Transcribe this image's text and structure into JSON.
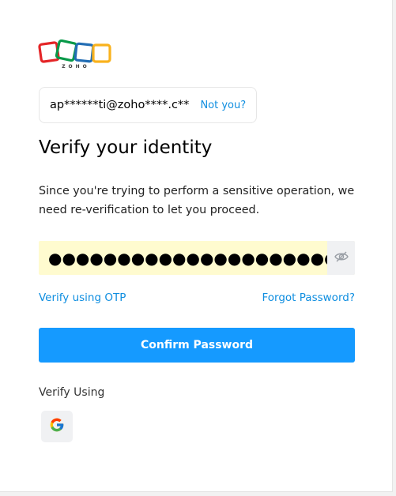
{
  "brand": {
    "logo_text": "ZOHO",
    "colors": {
      "red": "#e42527",
      "green": "#089949",
      "blue": "#226db4",
      "yellow": "#f9b21d"
    }
  },
  "account": {
    "email": "ap******ti@zoho****.c**",
    "not_you_label": "Not you?"
  },
  "heading": "Verify your identity",
  "description": "Since you're trying to perform a sensitive operation, we need re-verification to let you proceed.",
  "password": {
    "masked_value": "●●●●●●●●●●●●●●●●●●●●●●●●●●",
    "toggle_icon": "eye-hidden-icon"
  },
  "links": {
    "otp": "Verify using OTP",
    "forgot": "Forgot Password?"
  },
  "confirm_button": "Confirm Password",
  "verify_using": {
    "label": "Verify Using",
    "providers": [
      {
        "name": "google",
        "icon": "google-icon"
      }
    ]
  },
  "accent_color": "#159aff",
  "link_color": "#0f8ee0",
  "input_background": "#fffbcf"
}
